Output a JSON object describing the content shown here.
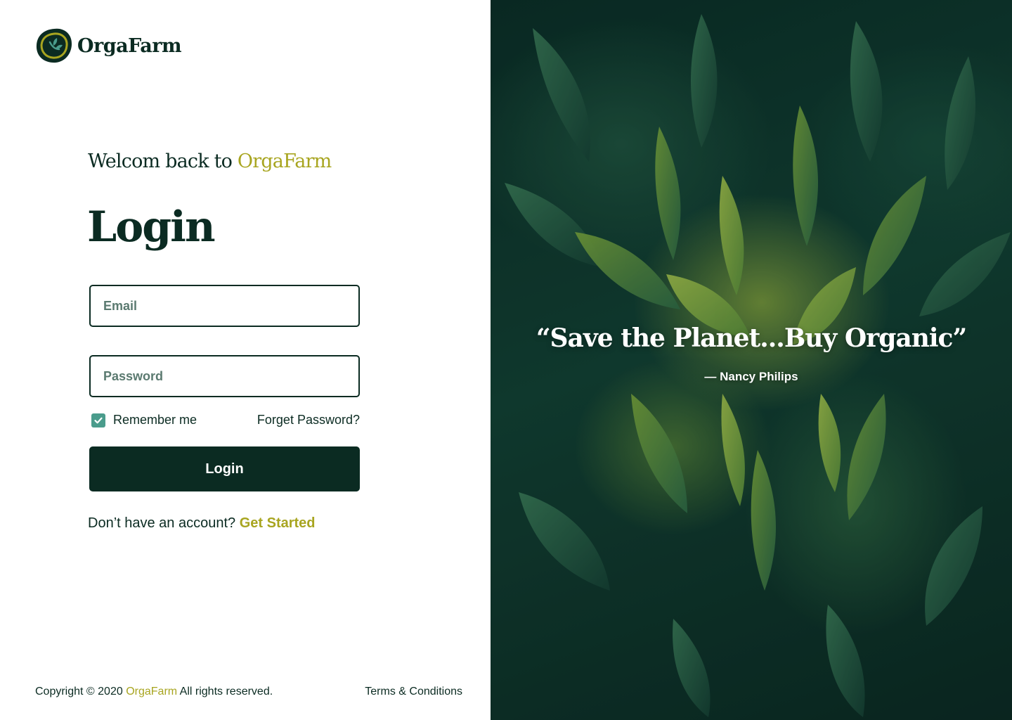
{
  "brand": {
    "name": "OrgaFarm",
    "logo_icon": "leaf-badge-icon"
  },
  "heading": {
    "welcome_prefix": "Welcom back to ",
    "welcome_brand": "OrgaFarm",
    "title": "Login"
  },
  "form": {
    "email_placeholder": "Email",
    "password_placeholder": "Password",
    "remember_label": "Remember me",
    "remember_checked": true,
    "forgot_label": "Forget Password?",
    "submit_label": "Login"
  },
  "signup": {
    "prompt": "Don’t have an account? ",
    "link_label": "Get Started"
  },
  "footer": {
    "copyright_prefix": "Copyright © 2020 ",
    "copyright_brand": "OrgaFarm",
    "copyright_suffix": " All rights reserved.",
    "terms_label": "Terms & Conditions"
  },
  "hero": {
    "quote": "“Save the Planet...Buy Organic”",
    "author": "— Nancy Philips"
  },
  "colors": {
    "primary": "#0b2b22",
    "accent": "#a8a520",
    "checkbox": "#4a9c8c"
  }
}
